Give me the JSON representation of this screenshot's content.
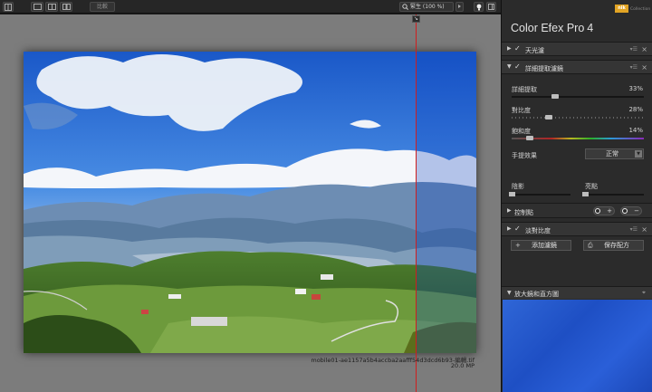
{
  "toolbar": {
    "zoom_label": "緊生 (100 %)",
    "view_button": "比較"
  },
  "canvas": {
    "file_name": "mobile01-ae1157a5b4accba2aafff54d3dcd6b93-編輯.tif",
    "file_size": "20.0 MP",
    "split_handle": "↘"
  },
  "panel": {
    "app_name": "Color Efex Pro",
    "app_version": "4",
    "logo_text": "nik",
    "logo_sub": "Collection",
    "filters": [
      {
        "name": "天光濾",
        "enabled": true
      },
      {
        "name": "詳細提取濾鏡",
        "enabled": true
      },
      {
        "name": "淡對比度",
        "enabled": true
      }
    ],
    "detail_sliders": [
      {
        "label": "詳細提取",
        "value": "33%",
        "level": 0.33
      },
      {
        "label": "對比度",
        "value": "28%",
        "level": 0.28
      },
      {
        "label": "飽和度",
        "value": "14%",
        "level": 0.14
      }
    ],
    "method": {
      "label": "手提效果",
      "value": "正常"
    },
    "shadows": {
      "label": "陰影",
      "level": 0
    },
    "highlights": {
      "label": "亮點",
      "level": 0
    },
    "control_points": {
      "label": "控制點",
      "add": "+",
      "remove": "−"
    },
    "add_filter": "添加濾鏡",
    "save_recipe": "保存配方",
    "loupe": {
      "label": "放大鏡和直方圖"
    },
    "header_ctrl": "▾☰",
    "close": "×",
    "pin": "⌖"
  },
  "colors": {
    "accent_red": "#d01e1e",
    "loupe_blue": "#2a5fd8"
  }
}
